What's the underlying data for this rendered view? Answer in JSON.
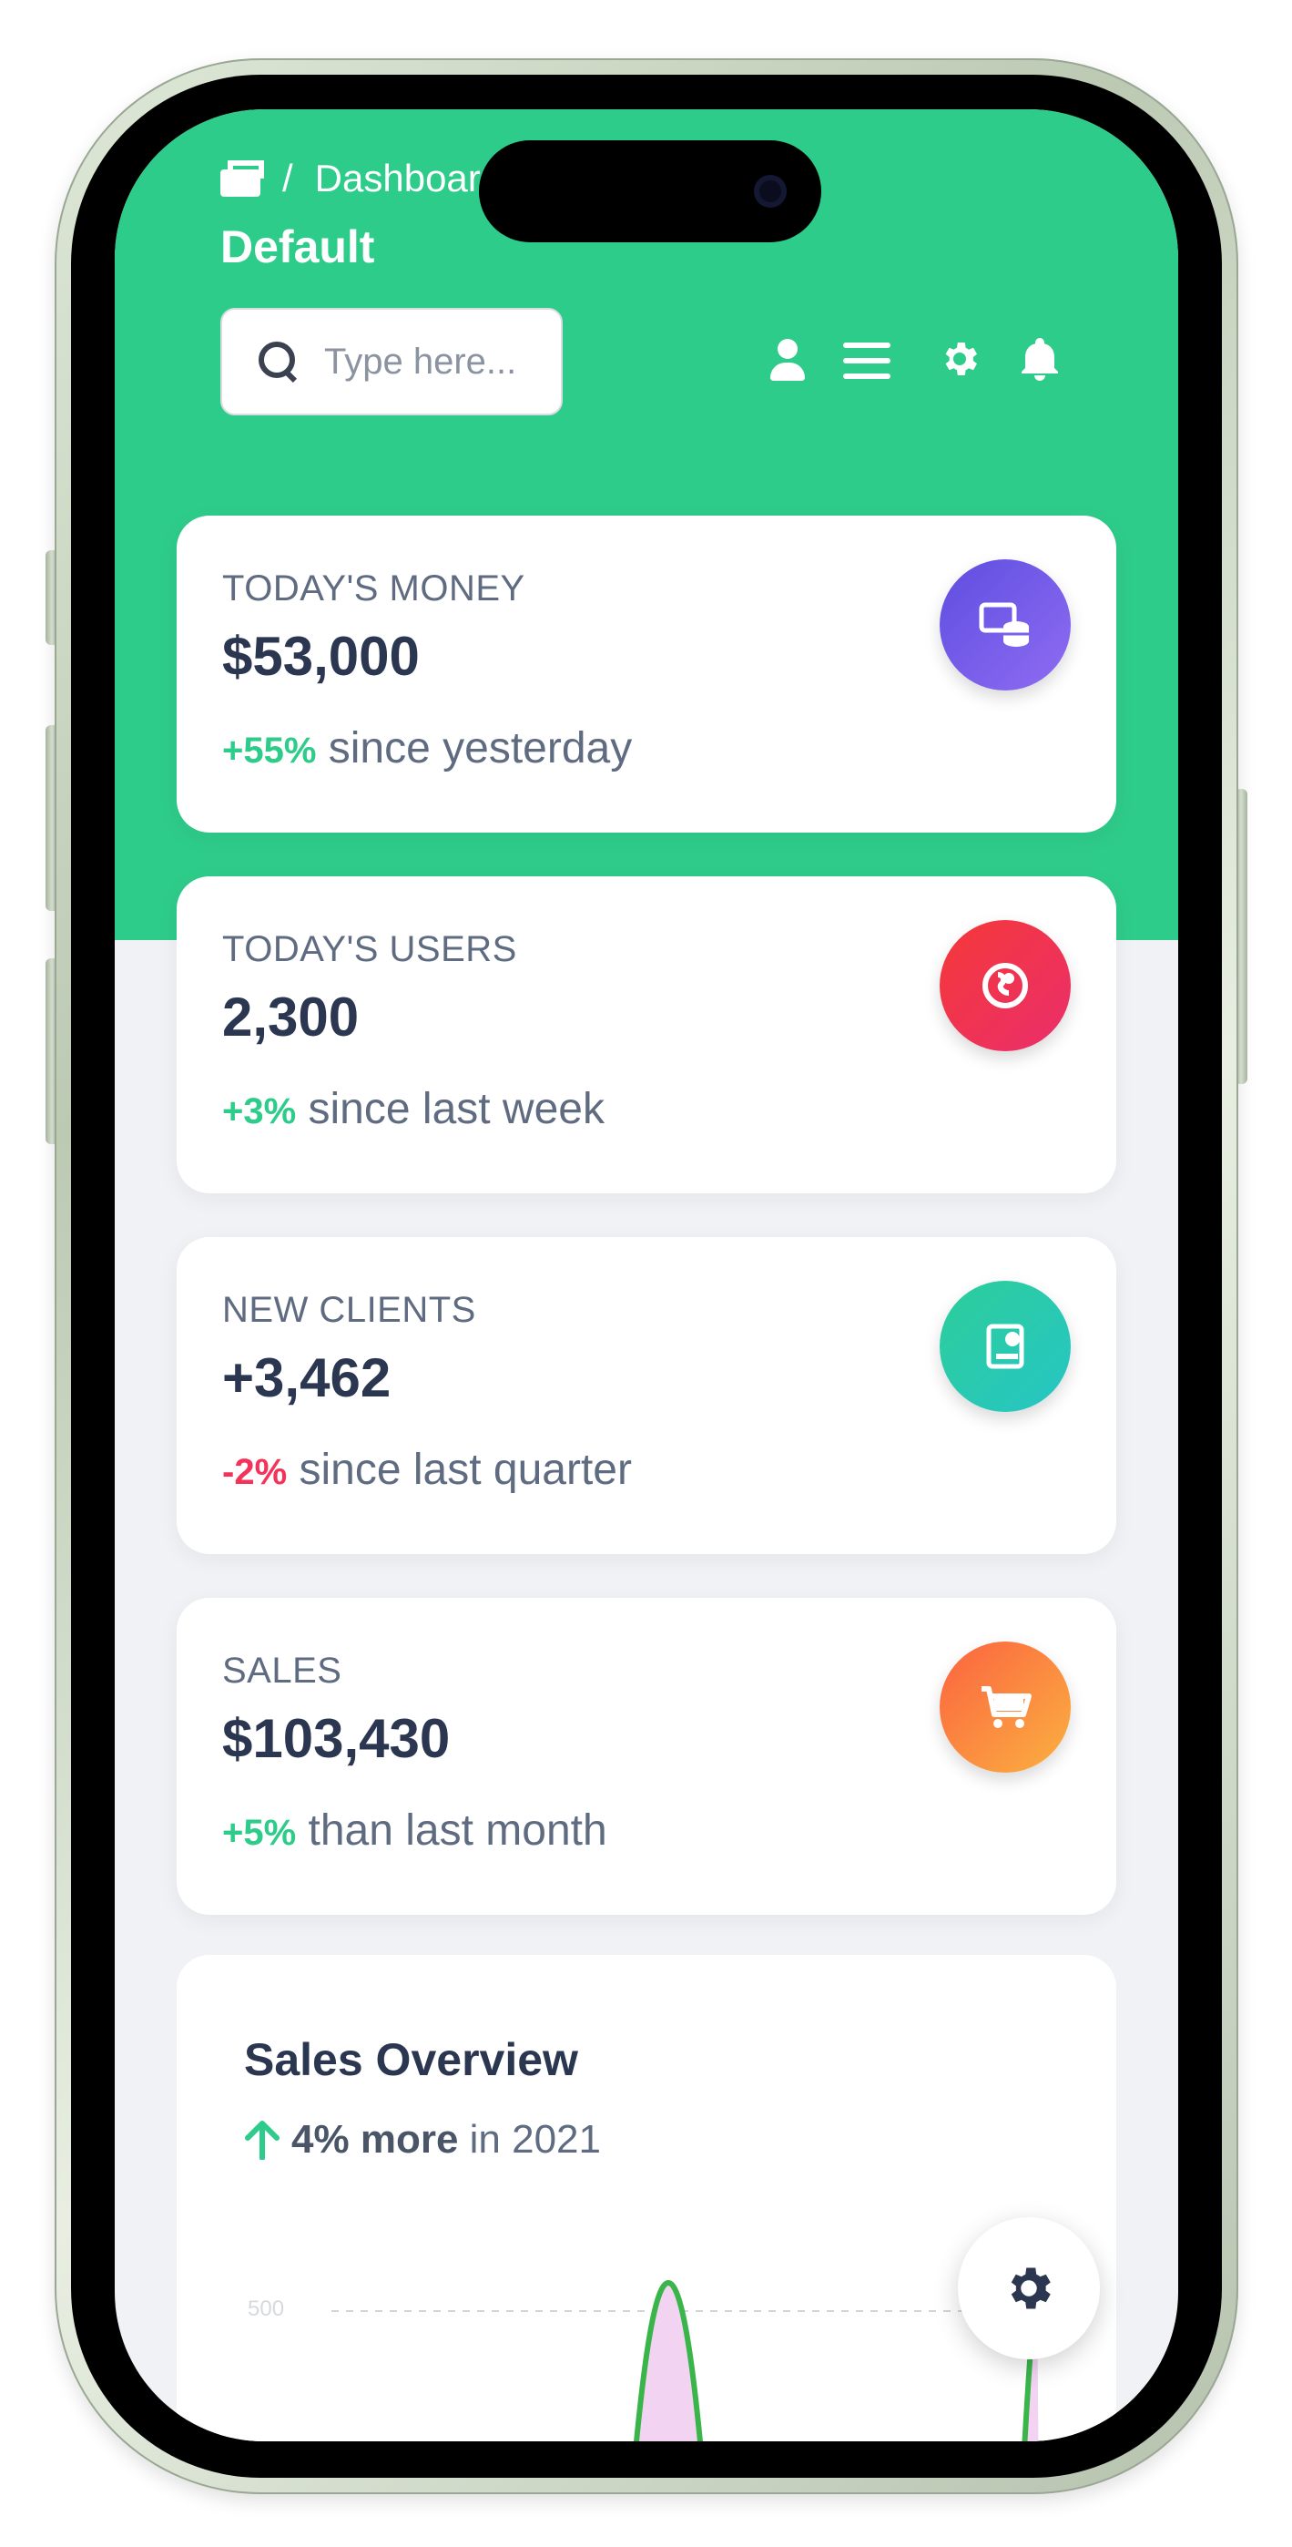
{
  "header": {
    "breadcrumb_sep": "/",
    "breadcrumb_page": "Dashboard",
    "title": "Default",
    "search_placeholder": "Type here...",
    "icons": [
      "user-icon",
      "menu-icon",
      "gear-icon",
      "bell-icon"
    ]
  },
  "colors": {
    "primary": "#2ecc8a",
    "positive": "#2ecc8a",
    "negative": "#f3335a",
    "money_badge": "#7b61e8",
    "users_badge": "#f0354d",
    "clients_badge": "#2bc8a6",
    "sales_badge": "#fb7a2c"
  },
  "stats": [
    {
      "label": "TODAY'S MONEY",
      "value": "$53,000",
      "change": "+55%",
      "change_type": "positive",
      "suffix": " since yesterday",
      "icon": "money-coins-icon"
    },
    {
      "label": "TODAY'S USERS",
      "value": "2,300",
      "change": "+3%",
      "change_type": "positive",
      "suffix": " since last week",
      "icon": "world-icon"
    },
    {
      "label": "NEW CLIENTS",
      "value": "+3,462",
      "change": "-2%",
      "change_type": "negative",
      "suffix": " since last quarter",
      "icon": "paper-diploma-icon"
    },
    {
      "label": "SALES",
      "value": "$103,430",
      "change": "+5%",
      "change_type": "positive",
      "suffix": " than last month",
      "icon": "cart-icon"
    }
  ],
  "sales_overview": {
    "title": "Sales Overview",
    "highlight": "4% more",
    "suffix": " in 2021",
    "arrow_icon": "arrow-up-icon"
  },
  "chart_data": {
    "type": "line",
    "y_tick_visible": "500"
  },
  "fab": {
    "icon": "gear-icon"
  }
}
